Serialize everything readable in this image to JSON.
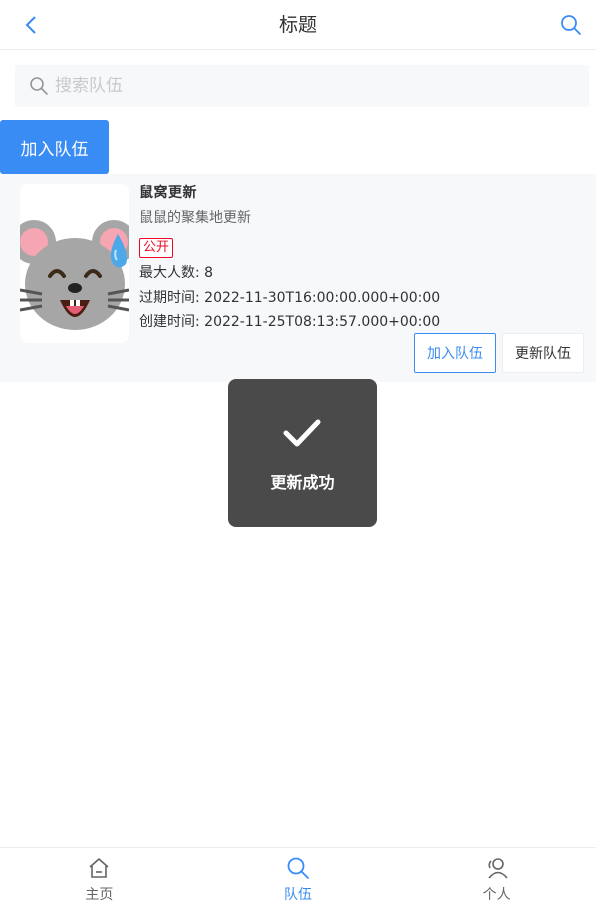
{
  "navbar": {
    "title": "标题",
    "back_icon": "chevron-left-icon",
    "search_icon": "search-icon"
  },
  "search": {
    "placeholder": "搜索队伍",
    "value": ""
  },
  "join_button_label": "加入队伍",
  "team_card": {
    "name": "鼠窝更新",
    "description": "鼠鼠的聚集地更新",
    "tag": "公开",
    "max_members": "最大人数: 8",
    "expire_time": "过期时间: 2022-11-30T16:00:00.000+00:00",
    "create_time": "创建时间: 2022-11-25T08:13:57.000+00:00",
    "thumb_icon": "mouse-sweat-emoji-icon",
    "join_label": "加入队伍",
    "update_label": "更新队伍"
  },
  "toast": {
    "text": "更新成功",
    "icon": "checkmark-icon"
  },
  "tabbar": {
    "items": [
      {
        "label": "主页",
        "icon": "home-icon",
        "active": false
      },
      {
        "label": "队伍",
        "icon": "search-icon",
        "active": true
      },
      {
        "label": "个人",
        "icon": "user-icon",
        "active": false
      }
    ]
  },
  "colors": {
    "primary": "#3a8cf5",
    "danger": "#ee0a24",
    "toast_bg": "#4a4a4a"
  }
}
